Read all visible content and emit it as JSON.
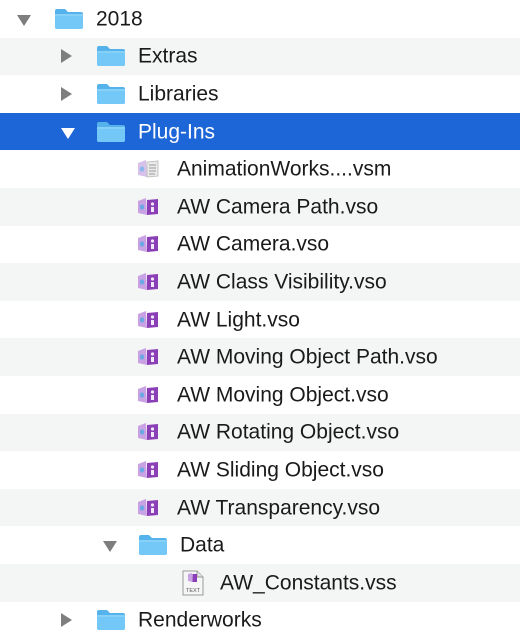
{
  "tree": {
    "rows": [
      {
        "label": "2018",
        "kind": "folder",
        "depth": 0,
        "state": "open",
        "icon": "folder-icon"
      },
      {
        "label": "Extras",
        "kind": "folder",
        "depth": 1,
        "state": "closed",
        "icon": "folder-icon"
      },
      {
        "label": "Libraries",
        "kind": "folder",
        "depth": 1,
        "state": "closed",
        "icon": "folder-icon"
      },
      {
        "label": "Plug-Ins",
        "kind": "folder",
        "depth": 1,
        "state": "open",
        "selected": true,
        "icon": "folder-icon"
      },
      {
        "label": "AnimationWorks....vsm",
        "kind": "vsm",
        "depth": 2,
        "icon": "vectorscript-menu-file-icon"
      },
      {
        "label": "AW Camera Path.vso",
        "kind": "vso",
        "depth": 2,
        "icon": "plugin-object-file-icon"
      },
      {
        "label": "AW Camera.vso",
        "kind": "vso",
        "depth": 2,
        "icon": "plugin-object-file-icon"
      },
      {
        "label": "AW Class Visibility.vso",
        "kind": "vso",
        "depth": 2,
        "icon": "plugin-object-file-icon"
      },
      {
        "label": "AW Light.vso",
        "kind": "vso",
        "depth": 2,
        "icon": "plugin-object-file-icon"
      },
      {
        "label": "AW Moving Object Path.vso",
        "kind": "vso",
        "depth": 2,
        "icon": "plugin-object-file-icon"
      },
      {
        "label": "AW Moving Object.vso",
        "kind": "vso",
        "depth": 2,
        "icon": "plugin-object-file-icon"
      },
      {
        "label": "AW Rotating Object.vso",
        "kind": "vso",
        "depth": 2,
        "icon": "plugin-object-file-icon"
      },
      {
        "label": "AW Sliding Object.vso",
        "kind": "vso",
        "depth": 2,
        "icon": "plugin-object-file-icon"
      },
      {
        "label": "AW Transparency.vso",
        "kind": "vso",
        "depth": 2,
        "icon": "plugin-object-file-icon"
      },
      {
        "label": "Data",
        "kind": "folder",
        "depth": 2,
        "state": "open",
        "icon": "folder-icon"
      },
      {
        "label": "AW_Constants.vss",
        "kind": "vss",
        "depth": 3,
        "icon": "text-script-file-icon",
        "icon_text": "TEXT"
      },
      {
        "label": "Renderworks",
        "kind": "folder",
        "depth": 1,
        "state": "closed",
        "icon": "folder-icon"
      }
    ]
  },
  "colors": {
    "selection": "#1d66d7",
    "alt_row": "#f4f5f5",
    "folder": "#6cc4f5",
    "folder_tab": "#56b2ea",
    "disclosure": "#7e7e7e",
    "plugin_purple": "#8a3fb6",
    "plugin_light": "#c9a2e3"
  }
}
